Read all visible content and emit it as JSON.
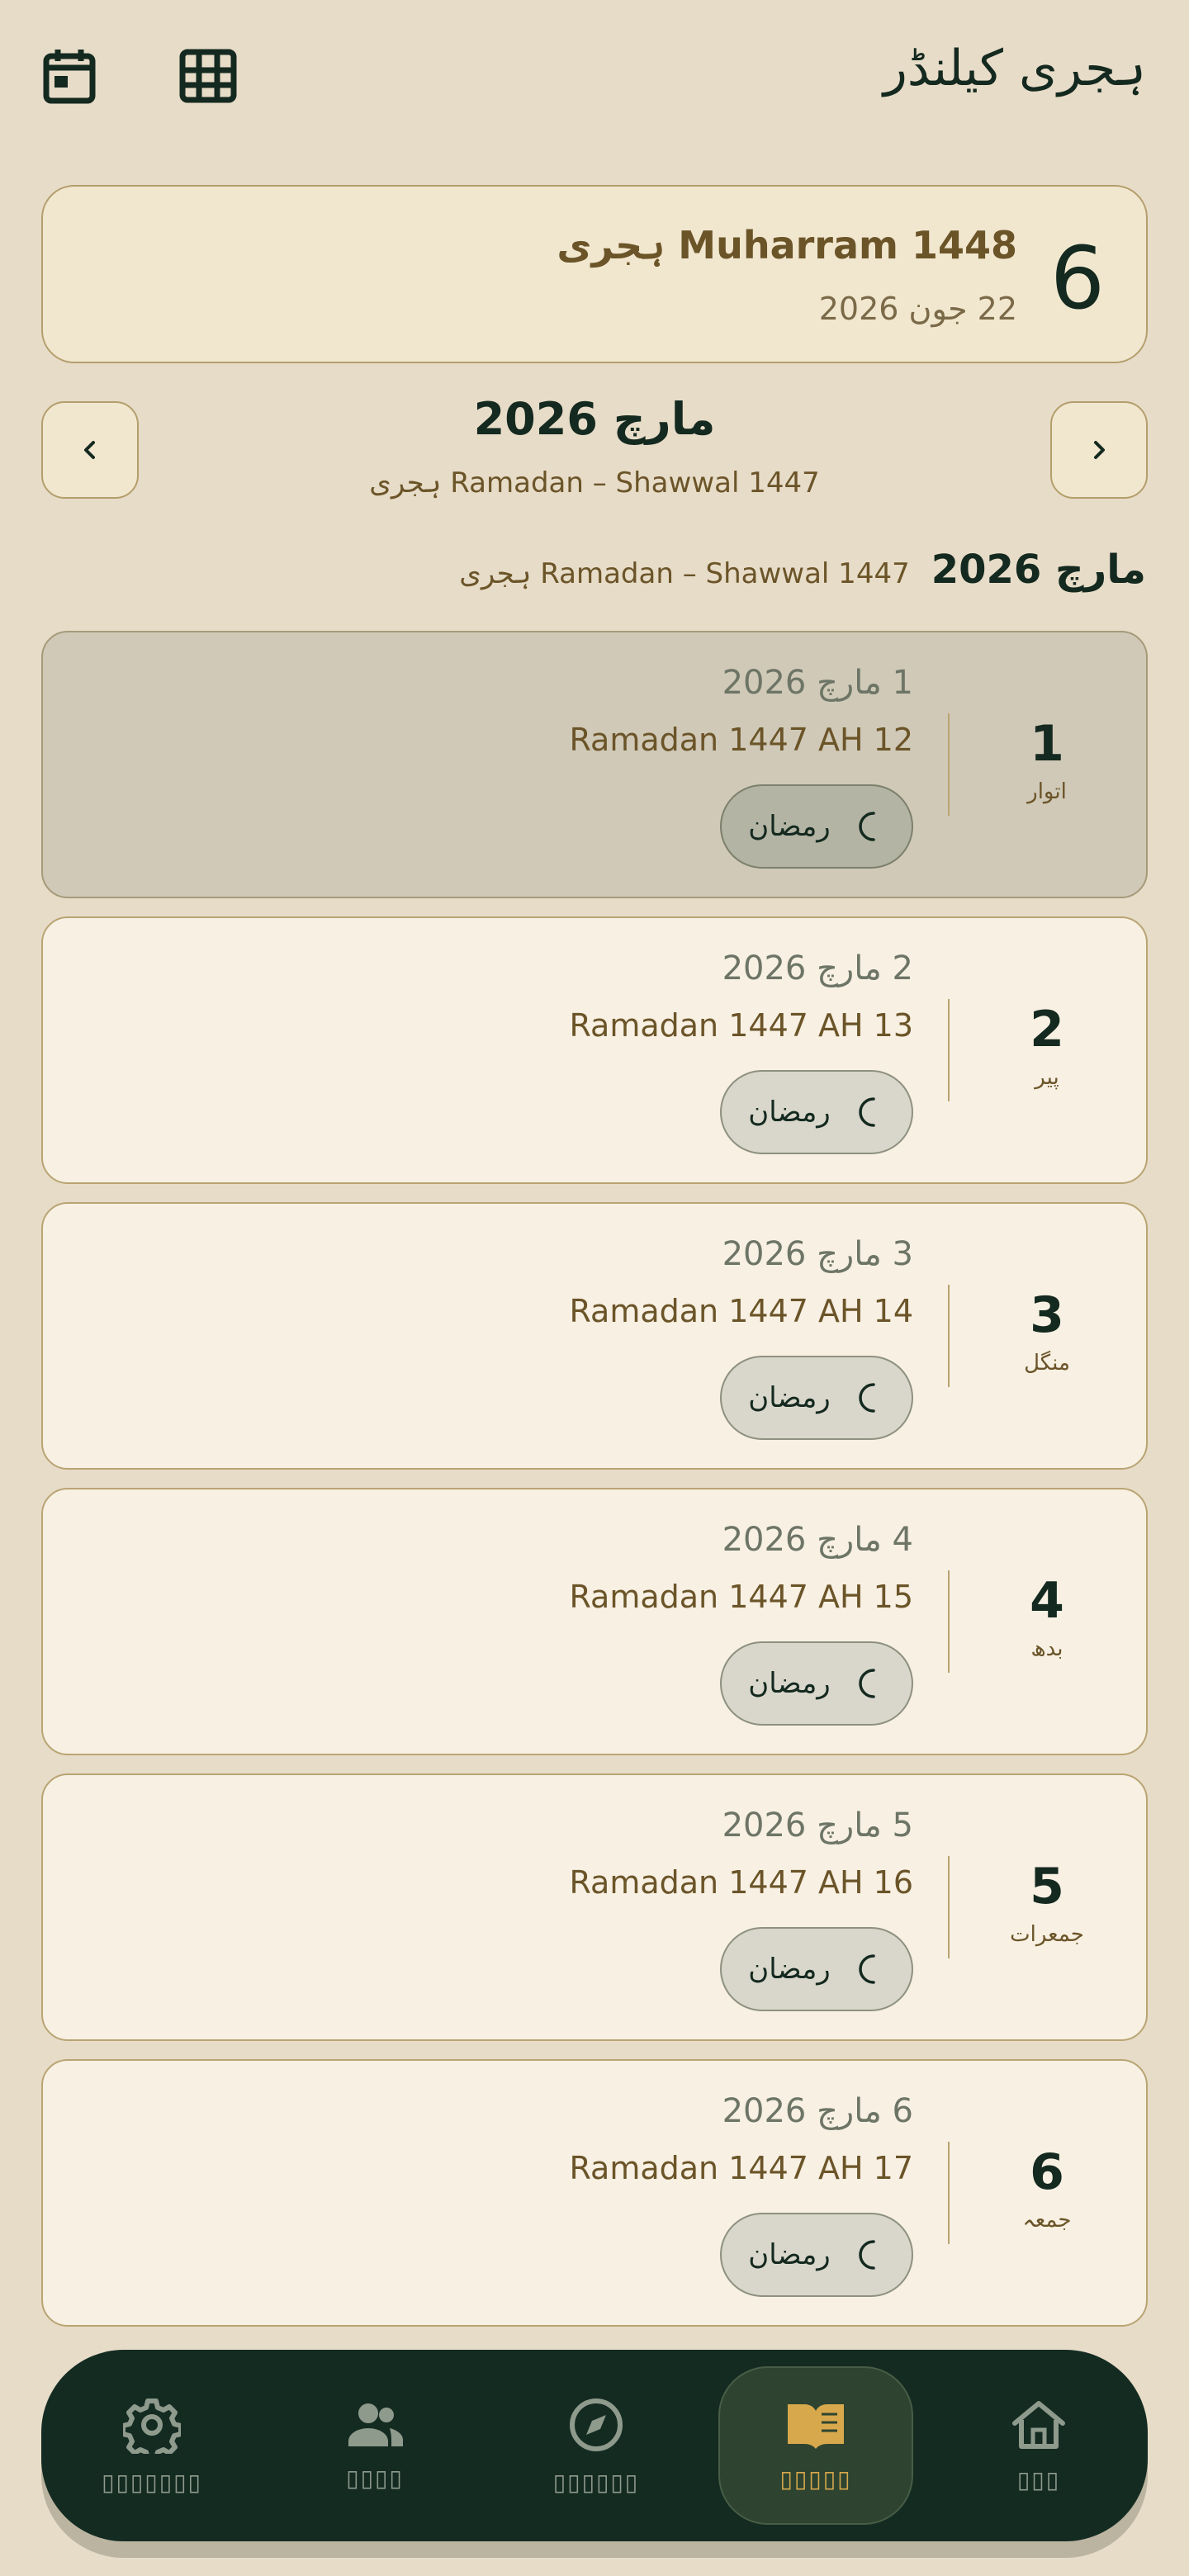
{
  "header": {
    "title": "ہجری کیلنڈر",
    "icons": [
      "calendar-icon",
      "grid-icon"
    ]
  },
  "today": {
    "day": "6",
    "hijri": "Muharram 1448 ہجری",
    "gregorian": "22 جون 2026"
  },
  "month_nav": {
    "title": "مارچ 2026",
    "subtitle": "Ramadan – Shawwal 1447 ہجری"
  },
  "section": {
    "month": "مارچ 2026",
    "subtitle": "Ramadan – Shawwal 1447 ہجری"
  },
  "days": [
    {
      "num": "1",
      "weekday": "اتوار",
      "gregorian": "1 مارچ 2026",
      "hijri": "Ramadan 1447 AH 12",
      "badge": "رمضان"
    },
    {
      "num": "2",
      "weekday": "پیر",
      "gregorian": "2 مارچ 2026",
      "hijri": "Ramadan 1447 AH 13",
      "badge": "رمضان"
    },
    {
      "num": "3",
      "weekday": "منگل",
      "gregorian": "3 مارچ 2026",
      "hijri": "Ramadan 1447 AH 14",
      "badge": "رمضان"
    },
    {
      "num": "4",
      "weekday": "بدھ",
      "gregorian": "4 مارچ 2026",
      "hijri": "Ramadan 1447 AH 15",
      "badge": "رمضان"
    },
    {
      "num": "5",
      "weekday": "جمعرات",
      "gregorian": "5 مارچ 2026",
      "hijri": "Ramadan 1447 AH 16",
      "badge": "رمضان"
    },
    {
      "num": "6",
      "weekday": "جمعہ",
      "gregorian": "6 مارچ 2026",
      "hijri": "Ramadan 1447 AH 17",
      "badge": "رمضان"
    }
  ],
  "bottom_nav": {
    "items": [
      {
        "icon": "gear-icon",
        "label": "▯▯▯▯▯▯▯"
      },
      {
        "icon": "people-icon",
        "label": "▯▯▯▯"
      },
      {
        "icon": "compass-icon",
        "label": "▯▯▯▯▯▯"
      },
      {
        "icon": "book-icon",
        "label": "▯▯▯▯▯"
      },
      {
        "icon": "home-icon",
        "label": "▯▯▯"
      }
    ]
  },
  "colors": {
    "background": "#e7dcc8",
    "primary_dark": "#142b22",
    "accent_gold": "#d8a84d",
    "card_bg": "#f7f0e3",
    "selected_card_bg": "#d0c9b7"
  }
}
